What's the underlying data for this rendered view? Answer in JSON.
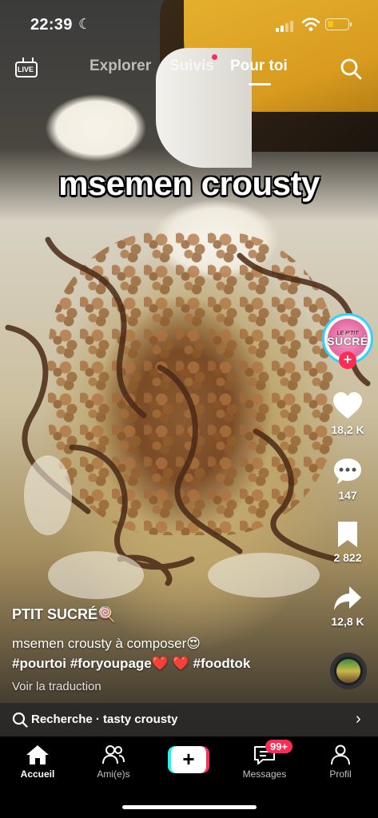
{
  "status_bar": {
    "time": "22:39",
    "battery_level": 0.3,
    "battery_color": "#f5c518"
  },
  "top_nav": {
    "live_label": "LIVE",
    "tabs": [
      {
        "label": "Explorer",
        "active": false
      },
      {
        "label": "Suivis",
        "active": false,
        "has_dot": true
      },
      {
        "label": "Pour toi",
        "active": true
      }
    ],
    "search_icon": "search-icon"
  },
  "video": {
    "overlay_caption": "msemen crousty"
  },
  "creator": {
    "avatar_small_text": "LE P'TIT",
    "avatar_brand": "SUCRÉ"
  },
  "actions": {
    "likes": "18,2 K",
    "comments": "147",
    "saves": "2 822",
    "shares": "12,8 K"
  },
  "post": {
    "author": "PTIT SUCRÉ🍭",
    "description": "msemen crousty à composer😍",
    "hashtags": "#pourtoi #foryoupage❤️ ❤️ #foodtok",
    "translate": "Voir la traduction"
  },
  "search_suggestion": {
    "text": "Recherche · tasty crousty"
  },
  "bottom_nav": {
    "items": [
      {
        "label": "Accueil",
        "icon": "home-icon",
        "active": true
      },
      {
        "label": "Ami(e)s",
        "icon": "friends-icon",
        "active": false
      },
      {
        "label": "+",
        "icon": "create-icon",
        "active": false
      },
      {
        "label": "Messages",
        "icon": "messages-icon",
        "active": false
      },
      {
        "label": "Profil",
        "icon": "profile-icon",
        "active": false
      }
    ],
    "messages_badge": "99+"
  },
  "colors": {
    "accent_red": "#fe2c55",
    "accent_cyan": "#25f4ee"
  }
}
